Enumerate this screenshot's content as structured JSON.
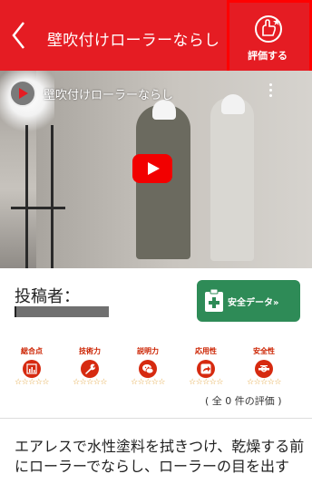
{
  "header": {
    "title": "壁吹付けローラーならし",
    "rate_label": "評価する",
    "bg_color": "#e51c23"
  },
  "video": {
    "title": "壁吹付けローラーならし",
    "play_icon": "play-icon"
  },
  "poster": {
    "label": "投稿者："
  },
  "safety_button": {
    "label": "安全データ»",
    "icon": "first-aid-icon",
    "bg_color": "#2e8b57"
  },
  "categories": [
    {
      "label": "総合点",
      "icon": "chart-icon",
      "stars": "☆☆☆☆☆"
    },
    {
      "label": "技術力",
      "icon": "wrench-icon",
      "stars": "☆☆☆☆☆"
    },
    {
      "label": "説明力",
      "icon": "chat-icon",
      "stars": "☆☆☆☆☆"
    },
    {
      "label": "応用性",
      "icon": "share-icon",
      "stars": "☆☆☆☆☆"
    },
    {
      "label": "安全性",
      "icon": "safety-icon",
      "stars": "☆☆☆☆☆"
    }
  ],
  "evaluation_count": "( 全 0 件の評価 )",
  "description": "エアレスで水性塗料を拭きつけ、乾燥する前にローラーでならし、ローラーの目を出す"
}
